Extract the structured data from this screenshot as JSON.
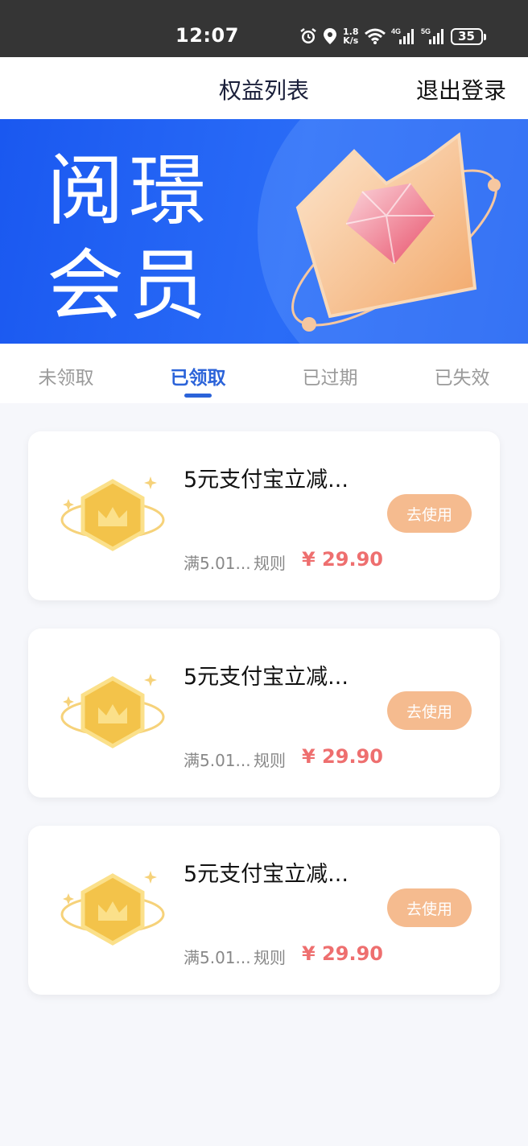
{
  "status_bar": {
    "time": "12:07",
    "net_speed_top": "1.8",
    "net_speed_bottom": "K/s",
    "battery": "35",
    "icons": [
      "alarm-icon",
      "location-icon",
      "wifi-icon",
      "signal-4g-icon",
      "signal-5g-icon",
      "battery-icon"
    ]
  },
  "header": {
    "title": "权益列表",
    "logout": "退出登录"
  },
  "banner": {
    "line1": "阅璟",
    "line2": "会员"
  },
  "tabs": [
    {
      "label": "未领取"
    },
    {
      "label": "已领取"
    },
    {
      "label": "已过期"
    },
    {
      "label": "已失效"
    }
  ],
  "active_tab": "已领取",
  "cards": [
    {
      "title": "5元支付宝立减...",
      "condition": "满5.01...",
      "rule": "规则",
      "price": "¥ 29.90",
      "button": "去使用"
    },
    {
      "title": "5元支付宝立减...",
      "condition": "满5.01...",
      "rule": "规则",
      "price": "¥ 29.90",
      "button": "去使用"
    },
    {
      "title": "5元支付宝立减...",
      "condition": "满5.01...",
      "rule": "规则",
      "price": "¥ 29.90",
      "button": "去使用"
    }
  ],
  "colors": {
    "accent": "#2b63d9",
    "price": "#ee6f6f",
    "button": "#f5bb8f",
    "banner": "#1a58f0"
  }
}
